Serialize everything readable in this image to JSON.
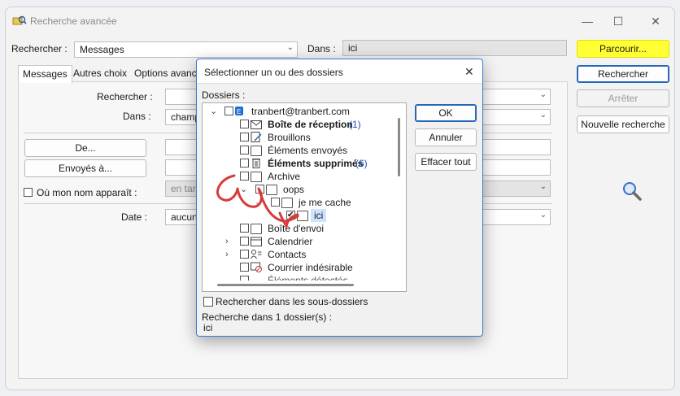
{
  "window": {
    "title": "Recherche avancée",
    "minimize": "—",
    "maximize": "☐",
    "close": "✕"
  },
  "top": {
    "rechercher_label": "Rechercher :",
    "rechercher_value": "Messages",
    "dans_label": "Dans :",
    "dans_value": "ici"
  },
  "right_buttons": {
    "parcourir": "Parcourir...",
    "rechercher": "Rechercher",
    "arreter": "Arrêter",
    "nouvelle": "Nouvelle recherche"
  },
  "tabs": [
    "Messages",
    "Autres choix",
    "Options avancé"
  ],
  "form": {
    "rechercher_label": "Rechercher :",
    "dans_label": "Dans :",
    "dans_value": "champ",
    "de_button": "De...",
    "envoyes_button": "Envoyés à...",
    "ou_mon_nom_label": "Où mon nom apparaît :",
    "ou_mon_nom_value": "en tant",
    "date_label": "Date :",
    "date_value": "aucune"
  },
  "dialog": {
    "title": "Sélectionner un ou des dossiers",
    "dossiers_label": "Dossiers :",
    "ok": "OK",
    "annuler": "Annuler",
    "effacer": "Effacer tout",
    "subfolders_label": "Rechercher dans les sous-dossiers",
    "status_label": "Recherche dans 1 dossier(s) :",
    "status_value": "ici",
    "tree": {
      "account": "tranbert@tranbert.com",
      "inbox": "Boîte de réception",
      "inbox_count": "(1)",
      "drafts": "Brouillons",
      "sent": "Éléments envoyés",
      "deleted": "Éléments supprimés",
      "deleted_count": "(6)",
      "archive": "Archive",
      "oops": "oops",
      "hidden": "je me cache",
      "ici": "ici",
      "outbox": "Boîte d'envoi",
      "calendar": "Calendrier",
      "contacts": "Contacts",
      "junk": "Courrier indésirable",
      "cut": "Éléments détectés"
    }
  },
  "colors": {
    "accent": "#2a66b8",
    "highlight": "#ffff33",
    "annotation": "#d83a3a"
  }
}
